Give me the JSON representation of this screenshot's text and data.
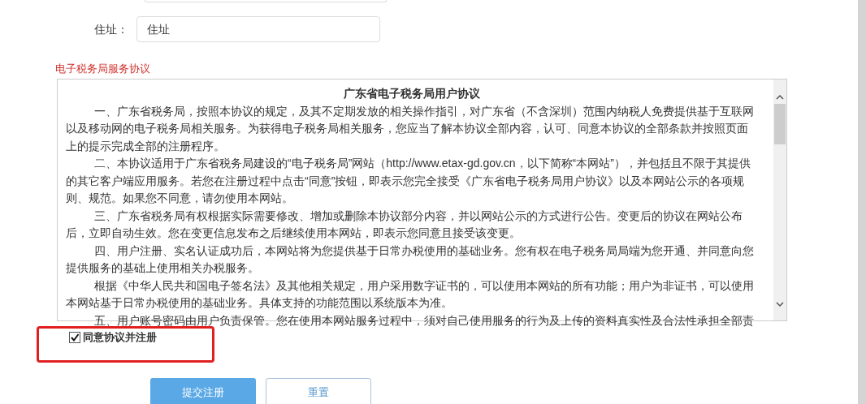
{
  "form": {
    "fields": [
      {
        "label": "住址：",
        "value": "住址"
      }
    ]
  },
  "agreement": {
    "heading": "电子税务局服务协议",
    "title": "广东省电子税务局用户协议",
    "paragraphs": [
      "一、广东省税务局，按照本协议的规定，及其不定期发放的相关操作指引，对广东省（不含深圳）范围内纳税人免费提供基于互联网以及移动网的电子税务局相关服务。为获得电子税务局相关服务，您应当了解本协议全部内容，认可、同意本协议的全部条款并按照页面上的提示完成全部的注册程序。",
      "二、本协议适用于广东省税务局建设的“电子税务局”网站（http://www.etax-gd.gov.cn，以下简称“本网站”），并包括且不限于其提供的其它客户端应用服务。若您在注册过程中点击“同意”按钮，即表示您完全接受《广东省电子税务局用户协议》以及本网站公示的各项规则、规范。如果您不同意，请勿使用本网站。",
      "三、广东省税务局有权根据实际需要修改、增加或删除本协议部分内容，并以网站公示的方式进行公告。变更后的协议在网站公布后，立即自动生效。您在变更信息发布之后继续使用本网站，即表示您同意且接受该变更。",
      "四、用户注册、实名认证成功后，本网站将为您提供基于日常办税使用的基础业务。您有权在电子税务局局端为您开通、并同意向您提供服务的基础上使用相关办税服务。",
      "根据《中华人民共和国电子签名法》及其他相关规定，用户采用数字证书的，可以使用本网站的所有功能；用户为非证书，可以使用本网站基于日常办税使用的基础业务。具体支持的功能范围以系统版本为准。",
      "五、用户账号密码由用户负责保管。您在使用本网站服务过程中，须对自己使用服务的行为及上传的资料真实性及合法性承担全部责"
    ]
  },
  "consent": {
    "label": "同意协议并注册",
    "checked": true
  },
  "buttons": [
    {
      "label": "提交注册",
      "kind": "primary"
    },
    {
      "label": "重置",
      "kind": "secondary"
    }
  ]
}
